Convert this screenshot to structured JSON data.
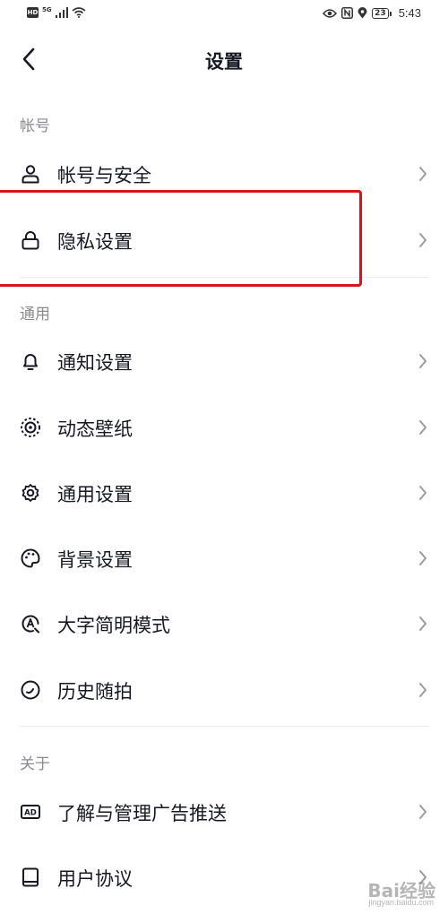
{
  "status_bar": {
    "hd": "HD",
    "network": "5G",
    "battery": "23",
    "time": "5:43"
  },
  "header": {
    "title": "设置"
  },
  "sections": {
    "account": {
      "title": "帐号",
      "items": [
        {
          "label": "帐号与安全",
          "icon": "user-icon"
        },
        {
          "label": "隐私设置",
          "icon": "lock-icon"
        }
      ]
    },
    "general": {
      "title": "通用",
      "items": [
        {
          "label": "通知设置",
          "icon": "bell-icon"
        },
        {
          "label": "动态壁纸",
          "icon": "live-wallpaper-icon"
        },
        {
          "label": "通用设置",
          "icon": "gear-icon"
        },
        {
          "label": "背景设置",
          "icon": "palette-icon"
        },
        {
          "label": "大字简明模式",
          "icon": "large-font-icon"
        },
        {
          "label": "历史随拍",
          "icon": "history-icon"
        }
      ]
    },
    "about": {
      "title": "关于",
      "items": [
        {
          "label": "了解与管理广告推送",
          "icon": "ad-icon"
        },
        {
          "label": "用户协议",
          "icon": "book-icon"
        }
      ]
    }
  },
  "watermark": {
    "main": "Bai经验",
    "sub": "jingyan.baidu.com"
  },
  "colors": {
    "highlight_box": "#d4161c",
    "text_primary": "#161823",
    "text_secondary": "#8a8b91"
  }
}
